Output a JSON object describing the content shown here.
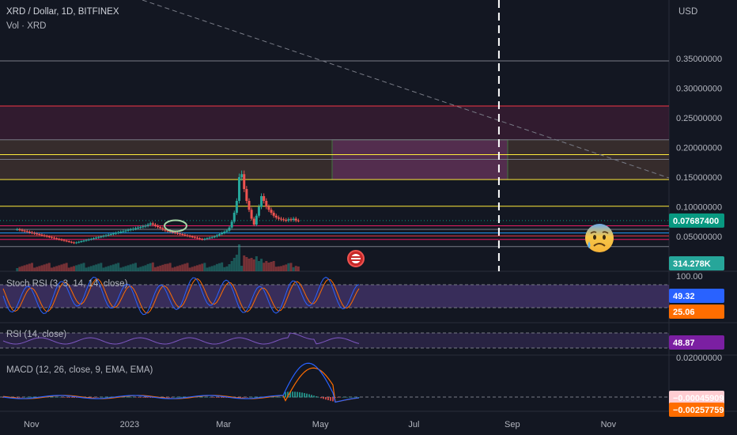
{
  "header": {
    "symbol_line": "XRD / Dollar, 1D, BITFINEX",
    "volume_line": "Vol · XRD",
    "currency": "USD"
  },
  "colors": {
    "background": "#131722",
    "candle_up": "#26a69a",
    "candle_down": "#ef5350",
    "price_tag": "#089981",
    "stoch_k": "#2962ff",
    "stoch_d": "#ff6d00",
    "stoch_band": "#7e57c2",
    "rsi_tag": "#7b1fa2",
    "macd_line": "#2962ff",
    "signal_line": "#ff6d00"
  },
  "icons": {
    "event_flag": "us-flag-icon",
    "emoji": "anxious-face-icon"
  },
  "panes": {
    "stoch": {
      "legend": "Stoch RSI (3, 3, 14, 14, close)",
      "top_value": "100.00",
      "k_value": "49.32",
      "d_value": "25.06"
    },
    "rsi": {
      "legend": "RSI (14, close)",
      "value": "48.87"
    },
    "macd": {
      "legend": "MACD (12, 26, close, 9, EMA, EMA)",
      "top_value": "0.02000000",
      "hist_value": "−0.00045909",
      "signal_value": "−0.00257759"
    }
  },
  "chart_data": {
    "type": "candlestick",
    "x_ticks": [
      "Nov",
      "2023",
      "Mar",
      "May",
      "Jul",
      "Sep",
      "Nov"
    ],
    "y_ticks": [
      "0.35000000",
      "0.30000000",
      "0.25000000",
      "0.20000000",
      "0.15000000",
      "0.10000000",
      "0.05000000"
    ],
    "y_tick_values": [
      0.35,
      0.3,
      0.25,
      0.2,
      0.15,
      0.1,
      0.05
    ],
    "ylim": [
      0.0,
      0.38
    ],
    "last_price": 0.076874,
    "last_price_label": "0.07687400",
    "volume_label": "314.278K",
    "horizontal_levels": [
      {
        "price": 0.346,
        "color": "#787b86"
      },
      {
        "price": 0.27,
        "color": "#f23645"
      },
      {
        "price": 0.213,
        "color": "#787b86"
      },
      {
        "price": 0.188,
        "color": "#ffeb3b"
      },
      {
        "price": 0.18,
        "color": "#787b86"
      },
      {
        "price": 0.146,
        "color": "#ffeb3b"
      },
      {
        "price": 0.101,
        "color": "#ffeb3b"
      },
      {
        "price": 0.068,
        "color": "#e91e63"
      },
      {
        "price": 0.062,
        "color": "#787b86"
      },
      {
        "price": 0.056,
        "color": "#2196f3"
      },
      {
        "price": 0.051,
        "color": "#f23645"
      },
      {
        "price": 0.045,
        "color": "#e91e63"
      },
      {
        "price": 0.033,
        "color": "#787b86"
      }
    ],
    "zone_boxes": [
      {
        "from_price": 0.27,
        "to_price": 0.146,
        "color": "#4a1f3a"
      },
      {
        "from_price": 0.213,
        "to_price": 0.146,
        "color": "#3a3a2a"
      }
    ],
    "highlight_box": {
      "from_price": 0.213,
      "to_price": 0.146,
      "color": "#4caf50"
    },
    "candles": {
      "start_month_index": -0.3,
      "closes": [
        0.062,
        0.061,
        0.06,
        0.059,
        0.058,
        0.057,
        0.056,
        0.055,
        0.054,
        0.053,
        0.052,
        0.051,
        0.05,
        0.049,
        0.048,
        0.047,
        0.046,
        0.045,
        0.044,
        0.043,
        0.042,
        0.041,
        0.04,
        0.039,
        0.04,
        0.041,
        0.042,
        0.043,
        0.044,
        0.045,
        0.046,
        0.047,
        0.048,
        0.049,
        0.05,
        0.051,
        0.052,
        0.053,
        0.054,
        0.055,
        0.056,
        0.057,
        0.058,
        0.059,
        0.06,
        0.061,
        0.062,
        0.063,
        0.064,
        0.065,
        0.066,
        0.067,
        0.068,
        0.07,
        0.072,
        0.07,
        0.068,
        0.066,
        0.064,
        0.062,
        0.06,
        0.059,
        0.058,
        0.057,
        0.056,
        0.055,
        0.054,
        0.053,
        0.052,
        0.051,
        0.05,
        0.049,
        0.048,
        0.047,
        0.046,
        0.045,
        0.046,
        0.047,
        0.048,
        0.049,
        0.05,
        0.052,
        0.054,
        0.056,
        0.058,
        0.06,
        0.065,
        0.075,
        0.09,
        0.11,
        0.15,
        0.155,
        0.13,
        0.11,
        0.095,
        0.08,
        0.07,
        0.085,
        0.1,
        0.118,
        0.11,
        0.1,
        0.095,
        0.09,
        0.085,
        0.082,
        0.08,
        0.079,
        0.078,
        0.077,
        0.079,
        0.078,
        0.08,
        0.077,
        0.076874
      ]
    },
    "future_marker": {
      "month_index": 9.9,
      "color": "#ffffff"
    }
  }
}
